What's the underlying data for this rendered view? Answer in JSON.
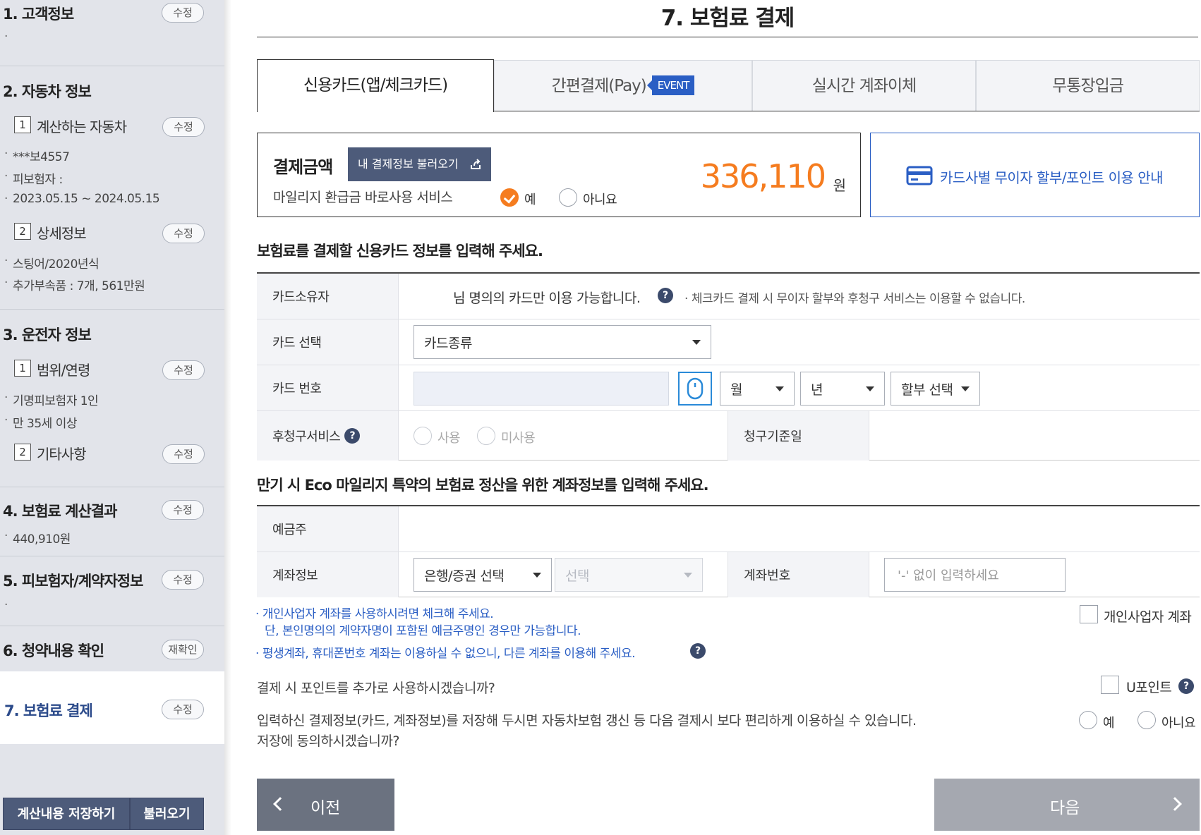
{
  "sidebar": {
    "sections": [
      {
        "title": "1. 고객정보",
        "edit": "수정",
        "bullets": [
          ""
        ]
      },
      {
        "title": "2. 자동차 정보",
        "subs": [
          {
            "num": "1",
            "title": "계산하는 자동차",
            "edit": "수정",
            "bullets": [
              "***보4557",
              "피보험자 :",
              "2023.05.15 ~ 2024.05.15"
            ]
          },
          {
            "num": "2",
            "title": "상세정보",
            "edit": "수정",
            "bullets": [
              "스팅어/2020년식",
              "추가부속품 : 7개, 561만원"
            ]
          }
        ]
      },
      {
        "title": "3. 운전자 정보",
        "subs": [
          {
            "num": "1",
            "title": "범위/연령",
            "edit": "수정",
            "bullets": [
              "기명피보험자 1인",
              "만 35세 이상"
            ]
          },
          {
            "num": "2",
            "title": "기타사항",
            "edit": "수정"
          }
        ]
      },
      {
        "title": "4. 보험료 계산결과",
        "edit": "수정",
        "bullets": [
          "440,910원"
        ]
      },
      {
        "title": "5. 피보험자/계약자정보",
        "edit": "수정",
        "bullets": [
          ""
        ]
      },
      {
        "title": "6. 청약내용 확인",
        "edit": "재확인"
      },
      {
        "title": "7. 보험료 결제",
        "edit": "수정"
      }
    ],
    "save_button": "계산내용 저장하기",
    "load_button": "불러오기"
  },
  "main": {
    "title": "7. 보험료 결제",
    "tabs": [
      {
        "label": "신용카드(앱/체크카드)"
      },
      {
        "label": "간편결제(Pay)",
        "badge": "EVENT"
      },
      {
        "label": "실시간 계좌이체"
      },
      {
        "label": "무통장입금"
      }
    ],
    "payment": {
      "label": "결제금액",
      "load_info_button": "내 결제정보 불러오기",
      "amount": "336,110",
      "unit": "원",
      "mileage_label": "마일리지 환급금 바로사용 서비스",
      "yes": "예",
      "no": "아니요"
    },
    "card_guide": "카드사별 무이자 할부/포인트 이용 안내",
    "card_section_heading": "보험료를 결제할 신용카드 정보를 입력해 주세요.",
    "card_form": {
      "owner_label": "카드소유자",
      "owner_text": "님 명의의 카드만 이용 가능합니다.",
      "owner_note": "체크카드 결제 시 무이자 할부와 후청구 서비스는 이용할 수 없습니다.",
      "select_label": "카드 선택",
      "card_type": "카드종류",
      "number_label": "카드 번호",
      "month": "월",
      "year": "년",
      "installment": "할부 선택",
      "postpay_label": "후청구서비스",
      "use": "사용",
      "not_use": "미사용",
      "billing_date_label": "청구기준일"
    },
    "account_section_heading": "만기 시 Eco 마일리지 특약의 보험료 정산을 위한 계좌정보를 입력해 주세요.",
    "account_form": {
      "holder_label": "예금주",
      "account_label": "계좌정보",
      "bank_select": "은행/증권 선택",
      "sub_select": "선택",
      "number_label": "계좌번호",
      "number_placeholder": "'-' 없이 입력하세요"
    },
    "notes": {
      "line1": "개인사업자 계좌를 사용하시려면 체크해 주세요.",
      "line2": "단, 본인명의의 계약자명이 포함된 예금주명인 경우만 가능합니다.",
      "line3": "평생계좌, 휴대폰번호 계좌는 이용하실 수 없으니, 다른 계좌를 이용해 주세요."
    },
    "business_account_label": "개인사업자 계좌",
    "points_question": "결제 시 포인트를 추가로 사용하시겠습니까?",
    "upoint_label": "U포인트",
    "save_question_line1": "입력하신 결제정보(카드, 계좌정보)를 저장해 두시면 자동차보험 갱신 등 다음 결제시 보다 편리하게 이용하실 수 있습니다.",
    "save_question_line2": "저장에 동의하시겠습니까?",
    "save_yes": "예",
    "save_no": "아니요",
    "prev_button": "이전",
    "next_button": "다음"
  },
  "colors": {
    "accent_orange": "#f57c1f",
    "accent_blue": "#2a5ec4",
    "navy": "#4d5b7a",
    "prev_button": "#6b7280",
    "next_button": "#a5a8b0"
  }
}
